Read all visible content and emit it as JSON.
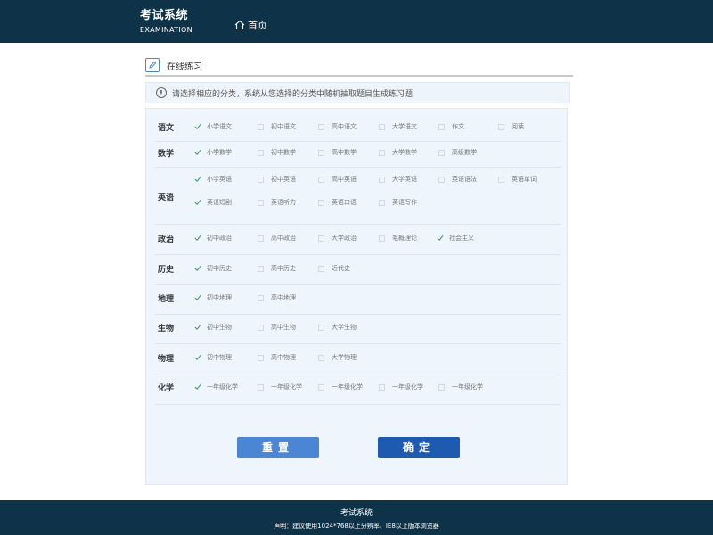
{
  "header": {
    "brand_cn": "考试系统",
    "brand_en": "EXAMINATION",
    "home_label": "首页"
  },
  "section": {
    "title": "在线练习"
  },
  "tip": {
    "text": "请选择相应的分类，系统从您选择的分类中随机抽取题目生成练习题"
  },
  "subjects": [
    {
      "name": "语文",
      "options": [
        {
          "label": "小学语文",
          "checked": true
        },
        {
          "label": "初中语文",
          "checked": false
        },
        {
          "label": "高中语文",
          "checked": false
        },
        {
          "label": "大学语文",
          "checked": false
        },
        {
          "label": "作文",
          "checked": false
        },
        {
          "label": "阅读",
          "checked": false
        }
      ]
    },
    {
      "name": "数学",
      "options": [
        {
          "label": "小学数学",
          "checked": true
        },
        {
          "label": "初中数学",
          "checked": false
        },
        {
          "label": "高中数学",
          "checked": false
        },
        {
          "label": "大学数学",
          "checked": false
        },
        {
          "label": "高级数学",
          "checked": false
        }
      ]
    },
    {
      "name": "英语",
      "options": [
        {
          "label": "小学英语",
          "checked": true
        },
        {
          "label": "初中英语",
          "checked": false
        },
        {
          "label": "高中英语",
          "checked": false
        },
        {
          "label": "大学英语",
          "checked": false
        },
        {
          "label": "英语语法",
          "checked": false
        },
        {
          "label": "英语单词",
          "checked": false
        },
        {
          "label": "英语短剧",
          "checked": true
        },
        {
          "label": "英语听力",
          "checked": false
        },
        {
          "label": "英语口语",
          "checked": false
        },
        {
          "label": "英语写作",
          "checked": false
        }
      ]
    },
    {
      "name": "政治",
      "options": [
        {
          "label": "初中政治",
          "checked": true
        },
        {
          "label": "高中政治",
          "checked": false
        },
        {
          "label": "大学政治",
          "checked": false
        },
        {
          "label": "毛概理论",
          "checked": false
        },
        {
          "label": "社会主义",
          "checked": true
        }
      ]
    },
    {
      "name": "历史",
      "options": [
        {
          "label": "初中历史",
          "checked": true
        },
        {
          "label": "高中历史",
          "checked": false
        },
        {
          "label": "近代史",
          "checked": false
        }
      ]
    },
    {
      "name": "地理",
      "options": [
        {
          "label": "初中地理",
          "checked": true
        },
        {
          "label": "高中地理",
          "checked": false
        }
      ]
    },
    {
      "name": "生物",
      "options": [
        {
          "label": "初中生物",
          "checked": true
        },
        {
          "label": "高中生物",
          "checked": false
        },
        {
          "label": "大学生物",
          "checked": false
        }
      ]
    },
    {
      "name": "物理",
      "options": [
        {
          "label": "初中物理",
          "checked": true
        },
        {
          "label": "高中物理",
          "checked": false
        },
        {
          "label": "大学物理",
          "checked": false
        }
      ]
    },
    {
      "name": "化学",
      "options": [
        {
          "label": "一年级化学",
          "checked": true
        },
        {
          "label": "一年级化学",
          "checked": false
        },
        {
          "label": "一年级化学",
          "checked": false
        },
        {
          "label": "一年级化学",
          "checked": false
        },
        {
          "label": "一年级化学",
          "checked": false
        }
      ]
    }
  ],
  "buttons": {
    "reset": "重置",
    "confirm": "确定"
  },
  "footer": {
    "title": "考试系统",
    "note": "声明：建议使用1024*768以上分辨率、IE8以上版本浏览器"
  },
  "colors": {
    "header_bg": "#0e3349",
    "check": "#3a9a5b",
    "reset_btn": "#4a86d4",
    "confirm_btn": "#1e5bb0",
    "panel_bg": "#eef5fc"
  }
}
